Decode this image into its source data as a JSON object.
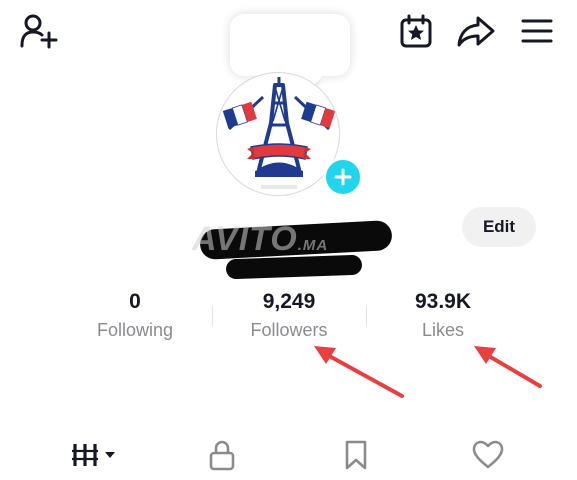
{
  "header": {
    "icons": [
      "add-friend-icon",
      "calendar-star-icon",
      "share-arrow-icon",
      "hamburger-menu-icon"
    ]
  },
  "profile": {
    "edit_label": "Edit",
    "watermark_text": "AVITO",
    "watermark_suffix": ".MA"
  },
  "stats": [
    {
      "value": "0",
      "label": "Following"
    },
    {
      "value": "9,249",
      "label": "Followers"
    },
    {
      "value": "93.9K",
      "label": "Likes"
    }
  ],
  "colors": {
    "accent_add": "#20d5ec",
    "annotation_arrow": "#e8403f",
    "flag_blue": "#1f3b8f",
    "flag_red": "#e03a3e"
  },
  "tabs": [
    "videos-grid-icon",
    "private-lock-icon",
    "favorites-bookmark-icon",
    "liked-heart-icon"
  ]
}
